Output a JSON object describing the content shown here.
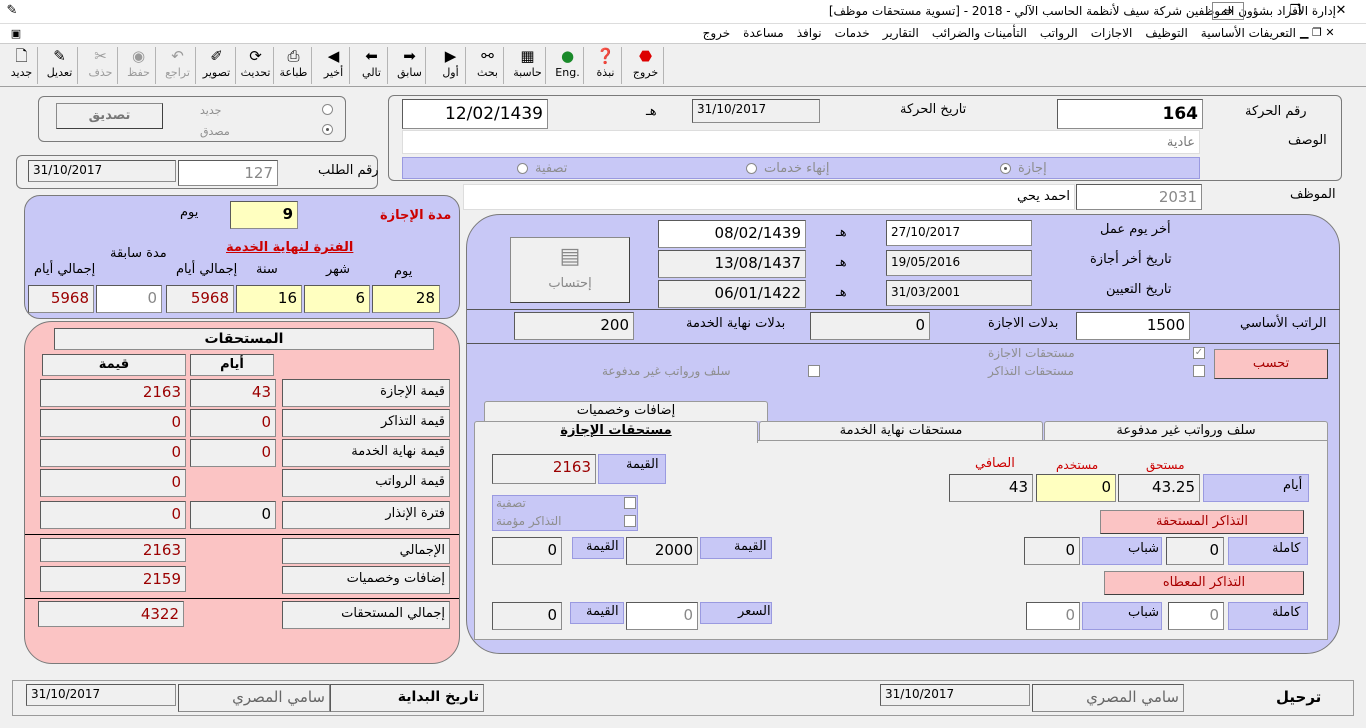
{
  "window": {
    "title": "إدارة الأفراد بشؤون الموظفين شركة سيف لأنظمة الحاسب الآلي - 2018 - [تسوية مستحقات موظف]"
  },
  "menu": [
    "التعريفات الأساسية",
    "التوظيف",
    "الاجازات",
    "الرواتب",
    "التأمينات والضرائب",
    "التقارير",
    "خدمات",
    "نوافذ",
    "مساعدة",
    "خروج"
  ],
  "toolbar": {
    "new": "جديد",
    "edit": "تعديل",
    "delete": "حذف",
    "save": "حفظ",
    "undo": "تراجع",
    "photo": "تصوير",
    "update": "تحديث",
    "print": "طباعة",
    "last": "أخير",
    "next": "تالي",
    "prev": "سابق",
    "first": "أول",
    "search": "بحث",
    "calc": "حاسبة",
    "eng": "Eng.",
    "about": "نبذة",
    "exit": "خروج"
  },
  "header": {
    "trans_no_label": "رقم الحركة",
    "trans_no": "164",
    "trans_date_label": "تاريخ الحركة",
    "trans_date": "31/10/2017",
    "hijri_suffix": "هـ",
    "trans_date_hijri": "12/02/1439",
    "desc_label": "الوصف",
    "desc": "عادية",
    "opt_leave": "إجازة",
    "opt_end": "إنهاء خدمات",
    "opt_settle": "تصفية",
    "approve_btn": "تصديق",
    "status_new": "جديد",
    "status_approved": "مصدق",
    "req_label": "رقم الطلب",
    "req_no": "127",
    "req_date": "31/10/2017",
    "emp_label": "الموظف",
    "emp_no": "2031",
    "emp_name": "احمد يحي"
  },
  "dates": {
    "last_work_label": "أخر يوم عمل",
    "last_work": "27/10/2017",
    "last_work_h": "08/02/1439",
    "last_leave_label": "تاريخ أخر أجازة",
    "last_leave": "19/05/2016",
    "last_leave_h": "13/08/1437",
    "hire_label": "تاريخ التعيين",
    "hire": "31/03/2001",
    "hire_h": "06/01/1422",
    "calc_btn": "إحتساب"
  },
  "salary": {
    "basic_label": "الراتب الأساسي",
    "basic": "1500",
    "leave_allow_label": "بدلات الاجازة",
    "leave_allow": "0",
    "end_allow_label": "بدلات نهاية الخدمة",
    "end_allow": "200"
  },
  "calc": {
    "btn": "تحسب",
    "chk_leave": "مستحقات الاجازة",
    "chk_tickets": "مستحقات التذاكر",
    "chk_advances": "سلف ورواتب غير مدفوعة"
  },
  "duration": {
    "label": "مدة الإجازة",
    "days_label": "يوم",
    "days": "9",
    "period_label": "الفترة لنهاية الخدمة",
    "prev_label": "مدة سابقة",
    "total_days_label": "إجمالي أيام",
    "year_label": "سنة",
    "month_label": "شهر",
    "day_label": "يوم",
    "prev_total": "5968",
    "prev": "0",
    "total": "5968",
    "years": "16",
    "months": "6",
    "days2": "28"
  },
  "dues": {
    "title": "المستحقات",
    "col_days": "أيام",
    "col_value": "قيمة",
    "rows": [
      {
        "label": "قيمة الإجازة",
        "days": "43",
        "value": "2163"
      },
      {
        "label": "قيمة التذاكر",
        "days": "0",
        "value": "0"
      },
      {
        "label": "قيمة نهاية الخدمة",
        "days": "0",
        "value": "0"
      },
      {
        "label": "قيمة الرواتب",
        "days": "",
        "value": "0"
      },
      {
        "label": "فترة الإنذار",
        "days": "0",
        "value": "0"
      }
    ],
    "total_label": "الإجمالي",
    "total": "2163",
    "adds_label": "إضافات وخصميات",
    "adds": "2159",
    "grand_label": "إجمالي المستحقات",
    "grand": "4322"
  },
  "tabs": {
    "adds": "إضافات وخصميات",
    "leave": "مستحقات الإجازة",
    "end": "مستحقات نهاية الخدمة",
    "adv": "سلف ورواتب غير مدفوعة"
  },
  "leave_tab": {
    "value_label": "القيمة",
    "value": "2163",
    "net_label": "الصافي",
    "used_label": "مستخدم",
    "due_label": "مستحق",
    "days_label": "أيام",
    "net": "43",
    "used": "0",
    "due": "43.25",
    "settle_chk": "تصفية",
    "tickets_chk": "التذاكر مؤمنة",
    "due_tickets_btn": "التذاكر المستحقة",
    "given_tickets_btn": "التذاكر المعطاه",
    "full_label": "كاملة",
    "youth_label": "شباب",
    "price_label": "القيمة",
    "rate_label": "السعر",
    "row1": {
      "full": "0",
      "youth": "0",
      "price": "2000",
      "value": "0"
    },
    "row2": {
      "full": "0",
      "youth": "0",
      "rate": "0",
      "value": "0"
    }
  },
  "footer": {
    "posted_label": "ترحيل",
    "posted_user": "سامي المصري",
    "posted_date": "31/10/2017",
    "start_label": "تاريخ البداية",
    "start_user": "سامي المصري",
    "start_date": "31/10/2017"
  }
}
